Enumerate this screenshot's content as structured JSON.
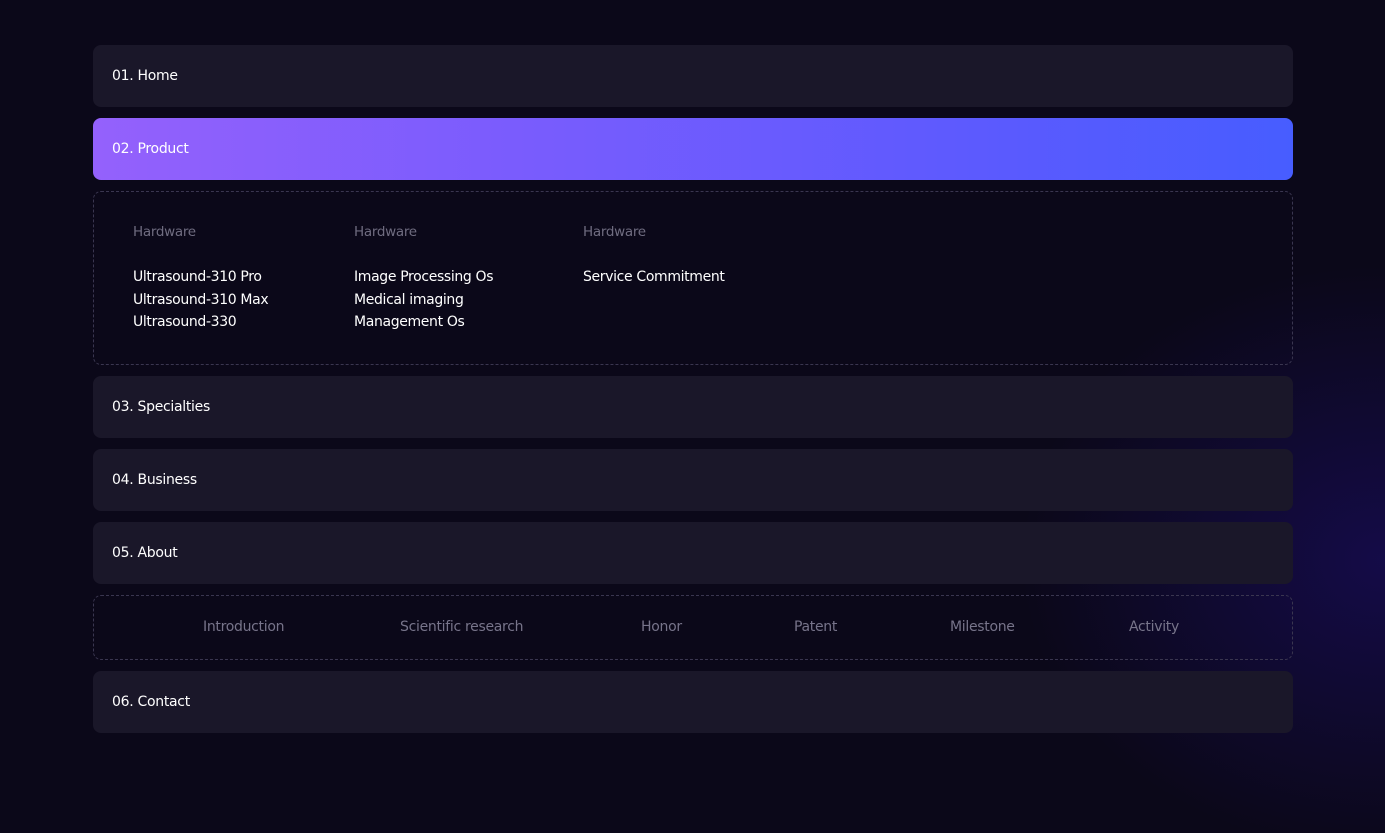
{
  "menu": {
    "home": "01. Home",
    "product": "02. Product",
    "specialties": "03. Specialties",
    "business": "04. Business",
    "about": "05. About",
    "contact": "06. Contact"
  },
  "product_submenu": {
    "columns": [
      {
        "heading": "Hardware",
        "links": [
          "Ultrasound-310 Pro",
          "Ultrasound-310 Max",
          "Ultrasound-330"
        ]
      },
      {
        "heading": "Hardware",
        "links": [
          "Image Processing Os",
          "Medical imaging",
          "Management Os"
        ]
      },
      {
        "heading": "Hardware",
        "links": [
          "Service Commitment"
        ]
      }
    ]
  },
  "about_submenu": {
    "links": [
      "Introduction",
      "Scientific research",
      "Honor",
      "Patent",
      "Milestone",
      "Activity"
    ]
  },
  "colors": {
    "background": "#0b0819",
    "item_background": "#1a1729",
    "active_gradient_start": "#9461fc",
    "active_gradient_end": "#475dff",
    "muted_text": "#6f6c80"
  }
}
